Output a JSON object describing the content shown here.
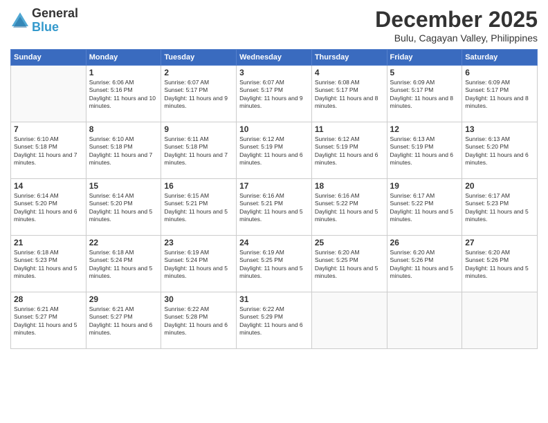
{
  "logo": {
    "general": "General",
    "blue": "Blue"
  },
  "header": {
    "month": "December 2025",
    "location": "Bulu, Cagayan Valley, Philippines"
  },
  "days_of_week": [
    "Sunday",
    "Monday",
    "Tuesday",
    "Wednesday",
    "Thursday",
    "Friday",
    "Saturday"
  ],
  "weeks": [
    [
      {
        "day": "",
        "sunrise": "",
        "sunset": "",
        "daylight": ""
      },
      {
        "day": "1",
        "sunrise": "Sunrise: 6:06 AM",
        "sunset": "Sunset: 5:16 PM",
        "daylight": "Daylight: 11 hours and 10 minutes."
      },
      {
        "day": "2",
        "sunrise": "Sunrise: 6:07 AM",
        "sunset": "Sunset: 5:17 PM",
        "daylight": "Daylight: 11 hours and 9 minutes."
      },
      {
        "day": "3",
        "sunrise": "Sunrise: 6:07 AM",
        "sunset": "Sunset: 5:17 PM",
        "daylight": "Daylight: 11 hours and 9 minutes."
      },
      {
        "day": "4",
        "sunrise": "Sunrise: 6:08 AM",
        "sunset": "Sunset: 5:17 PM",
        "daylight": "Daylight: 11 hours and 8 minutes."
      },
      {
        "day": "5",
        "sunrise": "Sunrise: 6:09 AM",
        "sunset": "Sunset: 5:17 PM",
        "daylight": "Daylight: 11 hours and 8 minutes."
      },
      {
        "day": "6",
        "sunrise": "Sunrise: 6:09 AM",
        "sunset": "Sunset: 5:17 PM",
        "daylight": "Daylight: 11 hours and 8 minutes."
      }
    ],
    [
      {
        "day": "7",
        "sunrise": "Sunrise: 6:10 AM",
        "sunset": "Sunset: 5:18 PM",
        "daylight": "Daylight: 11 hours and 7 minutes."
      },
      {
        "day": "8",
        "sunrise": "Sunrise: 6:10 AM",
        "sunset": "Sunset: 5:18 PM",
        "daylight": "Daylight: 11 hours and 7 minutes."
      },
      {
        "day": "9",
        "sunrise": "Sunrise: 6:11 AM",
        "sunset": "Sunset: 5:18 PM",
        "daylight": "Daylight: 11 hours and 7 minutes."
      },
      {
        "day": "10",
        "sunrise": "Sunrise: 6:12 AM",
        "sunset": "Sunset: 5:19 PM",
        "daylight": "Daylight: 11 hours and 6 minutes."
      },
      {
        "day": "11",
        "sunrise": "Sunrise: 6:12 AM",
        "sunset": "Sunset: 5:19 PM",
        "daylight": "Daylight: 11 hours and 6 minutes."
      },
      {
        "day": "12",
        "sunrise": "Sunrise: 6:13 AM",
        "sunset": "Sunset: 5:19 PM",
        "daylight": "Daylight: 11 hours and 6 minutes."
      },
      {
        "day": "13",
        "sunrise": "Sunrise: 6:13 AM",
        "sunset": "Sunset: 5:20 PM",
        "daylight": "Daylight: 11 hours and 6 minutes."
      }
    ],
    [
      {
        "day": "14",
        "sunrise": "Sunrise: 6:14 AM",
        "sunset": "Sunset: 5:20 PM",
        "daylight": "Daylight: 11 hours and 6 minutes."
      },
      {
        "day": "15",
        "sunrise": "Sunrise: 6:14 AM",
        "sunset": "Sunset: 5:20 PM",
        "daylight": "Daylight: 11 hours and 5 minutes."
      },
      {
        "day": "16",
        "sunrise": "Sunrise: 6:15 AM",
        "sunset": "Sunset: 5:21 PM",
        "daylight": "Daylight: 11 hours and 5 minutes."
      },
      {
        "day": "17",
        "sunrise": "Sunrise: 6:16 AM",
        "sunset": "Sunset: 5:21 PM",
        "daylight": "Daylight: 11 hours and 5 minutes."
      },
      {
        "day": "18",
        "sunrise": "Sunrise: 6:16 AM",
        "sunset": "Sunset: 5:22 PM",
        "daylight": "Daylight: 11 hours and 5 minutes."
      },
      {
        "day": "19",
        "sunrise": "Sunrise: 6:17 AM",
        "sunset": "Sunset: 5:22 PM",
        "daylight": "Daylight: 11 hours and 5 minutes."
      },
      {
        "day": "20",
        "sunrise": "Sunrise: 6:17 AM",
        "sunset": "Sunset: 5:23 PM",
        "daylight": "Daylight: 11 hours and 5 minutes."
      }
    ],
    [
      {
        "day": "21",
        "sunrise": "Sunrise: 6:18 AM",
        "sunset": "Sunset: 5:23 PM",
        "daylight": "Daylight: 11 hours and 5 minutes."
      },
      {
        "day": "22",
        "sunrise": "Sunrise: 6:18 AM",
        "sunset": "Sunset: 5:24 PM",
        "daylight": "Daylight: 11 hours and 5 minutes."
      },
      {
        "day": "23",
        "sunrise": "Sunrise: 6:19 AM",
        "sunset": "Sunset: 5:24 PM",
        "daylight": "Daylight: 11 hours and 5 minutes."
      },
      {
        "day": "24",
        "sunrise": "Sunrise: 6:19 AM",
        "sunset": "Sunset: 5:25 PM",
        "daylight": "Daylight: 11 hours and 5 minutes."
      },
      {
        "day": "25",
        "sunrise": "Sunrise: 6:20 AM",
        "sunset": "Sunset: 5:25 PM",
        "daylight": "Daylight: 11 hours and 5 minutes."
      },
      {
        "day": "26",
        "sunrise": "Sunrise: 6:20 AM",
        "sunset": "Sunset: 5:26 PM",
        "daylight": "Daylight: 11 hours and 5 minutes."
      },
      {
        "day": "27",
        "sunrise": "Sunrise: 6:20 AM",
        "sunset": "Sunset: 5:26 PM",
        "daylight": "Daylight: 11 hours and 5 minutes."
      }
    ],
    [
      {
        "day": "28",
        "sunrise": "Sunrise: 6:21 AM",
        "sunset": "Sunset: 5:27 PM",
        "daylight": "Daylight: 11 hours and 5 minutes."
      },
      {
        "day": "29",
        "sunrise": "Sunrise: 6:21 AM",
        "sunset": "Sunset: 5:27 PM",
        "daylight": "Daylight: 11 hours and 6 minutes."
      },
      {
        "day": "30",
        "sunrise": "Sunrise: 6:22 AM",
        "sunset": "Sunset: 5:28 PM",
        "daylight": "Daylight: 11 hours and 6 minutes."
      },
      {
        "day": "31",
        "sunrise": "Sunrise: 6:22 AM",
        "sunset": "Sunset: 5:29 PM",
        "daylight": "Daylight: 11 hours and 6 minutes."
      },
      {
        "day": "",
        "sunrise": "",
        "sunset": "",
        "daylight": ""
      },
      {
        "day": "",
        "sunrise": "",
        "sunset": "",
        "daylight": ""
      },
      {
        "day": "",
        "sunrise": "",
        "sunset": "",
        "daylight": ""
      }
    ]
  ]
}
